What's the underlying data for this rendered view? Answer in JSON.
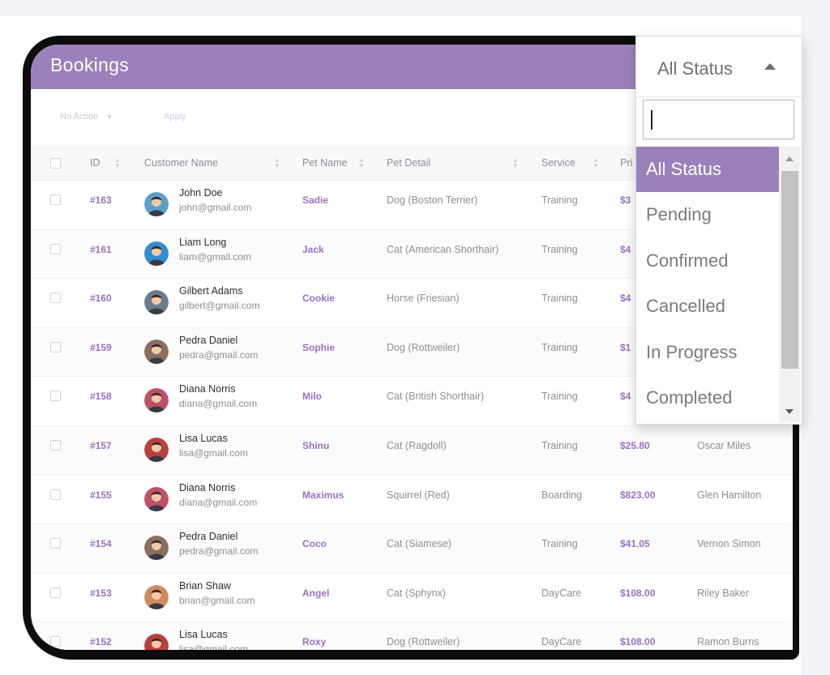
{
  "page": {
    "title": "Bookings"
  },
  "toolbar": {
    "bulk_action": "No Action",
    "apply_label": "Apply"
  },
  "table": {
    "columns": [
      "ID",
      "Customer Name",
      "Pet Name",
      "Pet Detail",
      "Service",
      "Pri"
    ],
    "rows": [
      {
        "id": "#163",
        "name": "John Doe",
        "email": "john@gmail.com",
        "pet": "Sadie",
        "detail": "Dog (Boston Terrier)",
        "service": "Training",
        "price": "$3",
        "staff": "",
        "avatar": "#5aa0c8"
      },
      {
        "id": "#161",
        "name": "Liam Long",
        "email": "liam@gmail.com",
        "pet": "Jack",
        "detail": "Cat (American Shorthair)",
        "service": "Training",
        "price": "$4",
        "staff": "",
        "avatar": "#2f8fd0"
      },
      {
        "id": "#160",
        "name": "Gilbert Adams",
        "email": "gilbert@gmail.com",
        "pet": "Cookie",
        "detail": "Horse (Friesian)",
        "service": "Training",
        "price": "$4",
        "staff": "",
        "avatar": "#6b7c8c"
      },
      {
        "id": "#159",
        "name": "Pedra Daniel",
        "email": "pedra@gmail.com",
        "pet": "Sophie",
        "detail": "Dog (Rottweiler)",
        "service": "Training",
        "price": "$1",
        "staff": "",
        "avatar": "#8a6e5e"
      },
      {
        "id": "#158",
        "name": "Diana Norris",
        "email": "diana@gmail.com",
        "pet": "Milo",
        "detail": "Cat (British Shorthair)",
        "service": "Training",
        "price": "$4",
        "staff": "",
        "avatar": "#c0506a"
      },
      {
        "id": "#157",
        "name": "Lisa Lucas",
        "email": "lisa@gmail.com",
        "pet": "Shinu",
        "detail": "Cat (Ragdoll)",
        "service": "Training",
        "price": "$25.80",
        "staff": "Oscar Miles",
        "avatar": "#b8403e"
      },
      {
        "id": "#155",
        "name": "Diana Norris",
        "email": "diana@gmail.com",
        "pet": "Maximus",
        "detail": "Squirrel (Red)",
        "service": "Boarding",
        "price": "$823.00",
        "staff": "Glen Hamilton",
        "avatar": "#c0506a"
      },
      {
        "id": "#154",
        "name": "Pedra Daniel",
        "email": "pedra@gmail.com",
        "pet": "Coco",
        "detail": "Cat (Siamese)",
        "service": "Training",
        "price": "$41.05",
        "staff": "Vernon Simon",
        "avatar": "#8a6e5e"
      },
      {
        "id": "#153",
        "name": "Brian Shaw",
        "email": "brian@gmail.com",
        "pet": "Angel",
        "detail": "Cat (Sphynx)",
        "service": "DayCare",
        "price": "$108.00",
        "staff": "Riley Baker",
        "avatar": "#d08a60"
      },
      {
        "id": "#152",
        "name": "Lisa Lucas",
        "email": "lisa@gmail.com",
        "pet": "Roxy",
        "detail": "Dog (Rottweiler)",
        "service": "DayCare",
        "price": "$108.00",
        "staff": "Ramon Burns",
        "avatar": "#b8403e"
      }
    ]
  },
  "status_filter": {
    "value": "All Status",
    "search_value": "",
    "options": [
      "All Status",
      "Pending",
      "Confirmed",
      "Cancelled",
      "In Progress",
      "Completed"
    ],
    "selected_index": 0
  },
  "colors": {
    "accent": "#9b81b9",
    "link": "#9b6fc4"
  },
  "icons": [
    "checkbox-icon",
    "sort-icon",
    "caret-down-icon",
    "caret-up-icon",
    "scroll-up-icon",
    "scroll-down-icon"
  ]
}
